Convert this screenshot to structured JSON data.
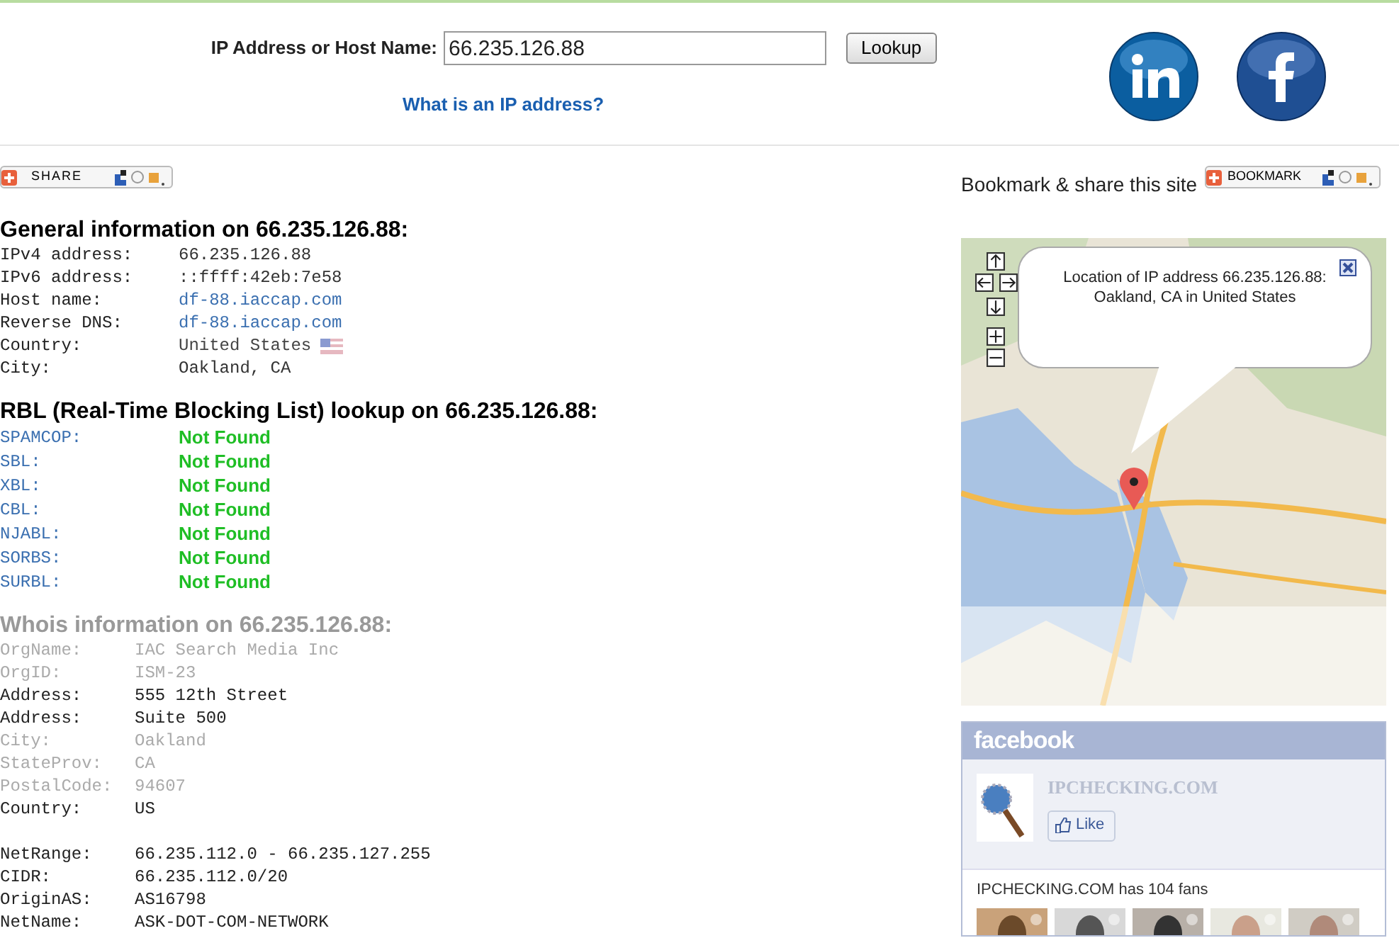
{
  "lookup": {
    "label": "IP Address or Host Name:",
    "value": "66.235.126.88",
    "button": "Lookup",
    "help_link": "What is an IP address?"
  },
  "share_button": {
    "label": "SHARE"
  },
  "bookmark": {
    "text": "Bookmark & share this site",
    "button": "BOOKMARK"
  },
  "general": {
    "title": "General information on 66.235.126.88:",
    "rows": [
      {
        "label": "IPv4 address:",
        "value": "66.235.126.88",
        "kind": "text"
      },
      {
        "label": "IPv6 address:",
        "value": "::ffff:42eb:7e58",
        "kind": "text"
      },
      {
        "label": "Host name:",
        "value": "df-88.iaccap.com",
        "kind": "link"
      },
      {
        "label": "Reverse DNS:",
        "value": "df-88.iaccap.com",
        "kind": "link"
      },
      {
        "label": "Country:",
        "value": "United States",
        "kind": "flag"
      },
      {
        "label": "City:",
        "value": "Oakland, CA",
        "kind": "text"
      }
    ]
  },
  "rbl": {
    "title": "RBL (Real-Time Blocking List) lookup on 66.235.126.88:",
    "rows": [
      {
        "label": "SPAMCOP:",
        "value": "Not Found"
      },
      {
        "label": "SBL:",
        "value": "Not Found"
      },
      {
        "label": "XBL:",
        "value": "Not Found"
      },
      {
        "label": "CBL:",
        "value": "Not Found"
      },
      {
        "label": "NJABL:",
        "value": "Not Found"
      },
      {
        "label": "SORBS:",
        "value": "Not Found"
      },
      {
        "label": "SURBL:",
        "value": "Not Found"
      }
    ]
  },
  "whois": {
    "title": "Whois information on 66.235.126.88:",
    "groups": [
      [
        {
          "label": "OrgName:",
          "value": "IAC Search Media Inc",
          "faded": true
        },
        {
          "label": "OrgID:",
          "value": "ISM-23",
          "faded": true
        },
        {
          "label": "Address:",
          "value": "555 12th Street",
          "faded": false
        },
        {
          "label": "Address:",
          "value": "Suite 500",
          "faded": false
        },
        {
          "label": "City:",
          "value": "Oakland",
          "faded": true
        },
        {
          "label": "StateProv:",
          "value": "CA",
          "faded": true
        },
        {
          "label": "PostalCode:",
          "value": "94607",
          "faded": true
        },
        {
          "label": "Country:",
          "value": "US",
          "faded": false
        }
      ],
      [
        {
          "label": "NetRange:",
          "value": "66.235.112.0 - 66.235.127.255",
          "faded": false
        },
        {
          "label": "CIDR:",
          "value": "66.235.112.0/20",
          "faded": false
        },
        {
          "label": "OriginAS:",
          "value": "AS16798",
          "faded": false
        },
        {
          "label": "NetName:",
          "value": "ASK-DOT-COM-NETWORK",
          "faded": false
        }
      ]
    ]
  },
  "map": {
    "popup": [
      "Location of IP address 66.235.126.88:",
      "Oakland, CA in United States"
    ]
  },
  "facebook": {
    "title": "facebook",
    "page_name": "IPCHECKING.COM",
    "like": "Like",
    "fans_text": "IPCHECKING.COM has 104 fans"
  }
}
